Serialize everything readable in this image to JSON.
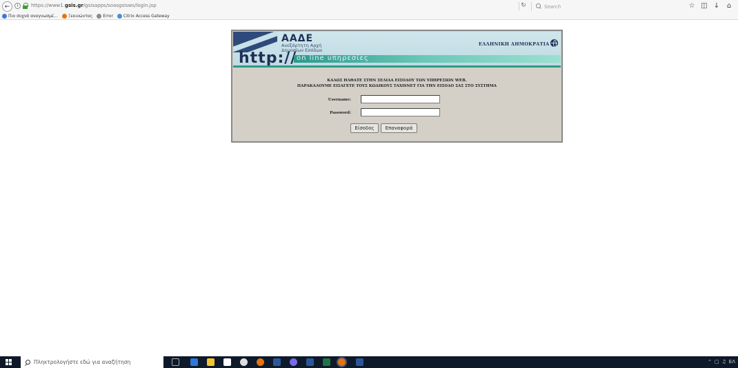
{
  "browser": {
    "url_prefix": "https://www1.",
    "url_domain": "gsis.gr",
    "url_path": "/gsisapps/soasgsisws/login.jsp",
    "search_placeholder": "Search"
  },
  "bookmarks": [
    {
      "label": "Πιο συχνά αναγνωσμέ...",
      "color": "#3b78d8"
    },
    {
      "label": "Ξεκινώντας",
      "color": "#e8720c"
    },
    {
      "label": "Error",
      "color": "#8a8a8a"
    },
    {
      "label": "Citrix Access Gateway",
      "color": "#4a8fd4"
    }
  ],
  "banner": {
    "org_abbr": "ΑΑΔΕ",
    "org_name_line1": "Ανεξάρτητη Αρχή",
    "org_name_line2": "Δημοσίων Εσόδων",
    "republic": "ΕΛΛΗΝΙΚΗ ΔΗΜΟΚΡΑΤΙΑ",
    "http_text": "http://",
    "online_text": "on line υπηρεσίες"
  },
  "login": {
    "welcome_line1": "ΚΑΛΩΣ ΗΛΘΑΤΕ ΣΤΗΝ ΣΕΛΙΔΑ ΕΙΣΟΔΟΥ ΤΩΝ ΥΠΗΡΕΣΙΩΝ WEB.",
    "welcome_line2": "ΠΑΡΑΚΑΛΟΥΜΕ ΕΙΣΑΓΕΤΕ ΤΟΥΣ ΚΩΔΙΚΟΥΣ TAXISNET ΓΙΑ ΤΗΝ ΕΙΣΟΔΟ ΣΑΣ ΣΤΟ ΣΥΣΤΗΜΑ",
    "username_label": "Username:",
    "username_value": "",
    "password_label": "Password:",
    "password_value": "",
    "submit_label": "Είσοδος",
    "reset_label": "Επαναφορά"
  },
  "taskbar": {
    "search_placeholder": "Πληκτρολογήστε εδώ για αναζήτηση",
    "tray_language": "ΕΛ"
  }
}
